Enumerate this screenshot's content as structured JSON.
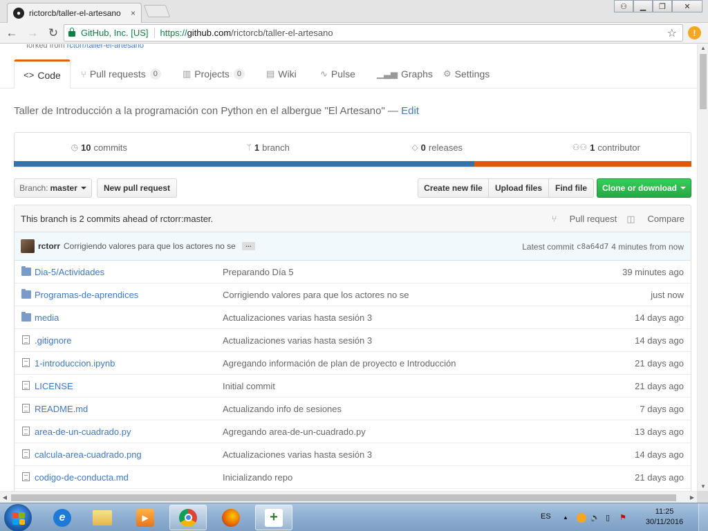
{
  "browser": {
    "tab_title": "rictorcb/taller-el-artesano",
    "tab_close": "×",
    "ev_label": "GitHub, Inc. [US]",
    "url_protocol": "https://",
    "url_host": "github.com",
    "url_path": "/rictorcb/taller-el-artesano",
    "window_controls": [
      "person-icon",
      "minimize-icon",
      "restore-icon",
      "close-icon"
    ]
  },
  "repo": {
    "forked_from_prefix": "forked from",
    "forked_from_link": "rctorr/taller-el-artesano",
    "nav": [
      {
        "label": "Code",
        "icon": "code-icon"
      },
      {
        "label": "Pull requests",
        "count": "0",
        "icon": "pull-request-icon"
      },
      {
        "label": "Projects",
        "count": "0",
        "icon": "project-icon"
      },
      {
        "label": "Wiki",
        "icon": "book-icon"
      },
      {
        "label": "Pulse",
        "icon": "pulse-icon"
      },
      {
        "label": "Graphs",
        "icon": "graph-icon"
      },
      {
        "label": "Settings",
        "icon": "gear-icon"
      }
    ],
    "description": "Taller de Introducción a la programación con Python en el albergue \"El Artesano\"",
    "description_sep": " — ",
    "edit_label": "Edit",
    "summary": {
      "commits_count": "10",
      "commits_label": "commits",
      "branch_count": "1",
      "branch_label": "branch",
      "releases_count": "0",
      "releases_label": "releases",
      "contributor_count": "1",
      "contributor_label": "contributor"
    },
    "language_colors": [
      "#3572a5",
      "#da5b0b"
    ],
    "language_fractions": [
      0.68,
      0.32
    ]
  },
  "file_nav": {
    "branch_prefix": "Branch:",
    "branch_name": "master",
    "new_pull_request": "New pull request",
    "create_new_file": "Create new file",
    "upload_files": "Upload files",
    "find_file": "Find file",
    "clone_or_download": "Clone or download"
  },
  "branch_info": {
    "text": "This branch is 2 commits ahead of rctorr:master.",
    "pull_request": "Pull request",
    "compare": "Compare"
  },
  "latest_commit": {
    "author": "rctorr",
    "message": "Corrigiendo valores para que los actores no se",
    "ellipsis": "…",
    "prefix": "Latest commit",
    "sha": "c8a64d7",
    "age": "4 minutes from now"
  },
  "files": [
    {
      "dir_part": "Dia-5/",
      "name": "Actividades",
      "type": "dir",
      "message": "Preparando Día 5",
      "age": "39 minutes ago"
    },
    {
      "dir_part": "",
      "name": "Programas-de-aprendices",
      "type": "dir",
      "message": "Corrigiendo valores para que los actores no se",
      "age": "just now"
    },
    {
      "dir_part": "",
      "name": "media",
      "type": "dir",
      "message": "Actualizaciones varias hasta sesión 3",
      "age": "14 days ago"
    },
    {
      "dir_part": "",
      "name": ".gitignore",
      "type": "file",
      "message": "Actualizaciones varias hasta sesión 3",
      "age": "14 days ago"
    },
    {
      "dir_part": "",
      "name": "1-introduccion.ipynb",
      "type": "file",
      "message": "Agregando información de plan de proyecto e Introducción",
      "age": "21 days ago"
    },
    {
      "dir_part": "",
      "name": "LICENSE",
      "type": "file",
      "message": "Initial commit",
      "age": "21 days ago"
    },
    {
      "dir_part": "",
      "name": "README.md",
      "type": "file",
      "message": "Actualizando info de sesiones",
      "age": "7 days ago"
    },
    {
      "dir_part": "",
      "name": "area-de-un-cuadrado.py",
      "type": "file",
      "message": "Agregando area-de-un-cuadrado.py",
      "age": "13 days ago"
    },
    {
      "dir_part": "",
      "name": "calcula-area-cuadrado.png",
      "type": "file",
      "message": "Actualizaciones varias hasta sesión 3",
      "age": "14 days ago"
    },
    {
      "dir_part": "",
      "name": "codigo-de-conducta.md",
      "type": "file",
      "message": "Inicializando repo",
      "age": "21 days ago"
    }
  ],
  "taskbar": {
    "language": "ES",
    "time": "11:25",
    "date": "30/11/2016",
    "pinned": [
      "internet-explorer-icon",
      "file-explorer-icon",
      "media-player-icon",
      "chrome-icon",
      "firefox-icon",
      "git-icon"
    ]
  }
}
